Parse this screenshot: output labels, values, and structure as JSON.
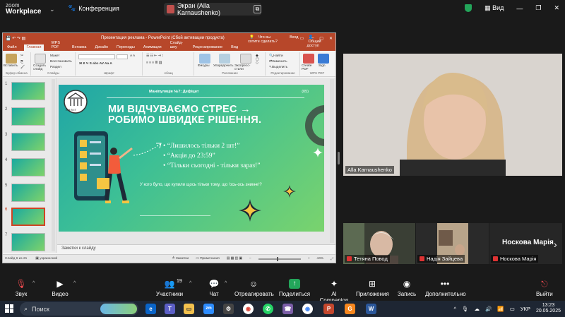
{
  "zoom": {
    "logo_top": "zoom",
    "logo_bottom": "Workplace",
    "meeting_title": "Конференция",
    "share_label": "Экран (Alla Karnaushenko)",
    "view_label": "Вид"
  },
  "ppt": {
    "window_title": "Презентация реклама - PowerPoint (Сбой активации продукта)",
    "tabs": [
      "Файл",
      "Главная",
      "WPS PDF",
      "Вставка",
      "Дизайн",
      "Переходы",
      "Анимация",
      "Слайд-шоу",
      "Рецензирование",
      "Вид"
    ],
    "active_tab": "Главная",
    "tell_me": "Что вы хотите сделать?",
    "login": "Вход",
    "share": "Общий доступ",
    "ribbon": {
      "paste": "Вставить",
      "cut": "Макет",
      "copy": "Восстановить",
      "format": "Раздел",
      "new_slide": "Создать слайд",
      "clipboard": "Буфер обмена",
      "slides": "Слайды",
      "font": "Шрифт",
      "paragraph": "Абзац",
      "shapes": "Фигуры",
      "arrange": "Упорядочить",
      "quick_styles": "Экспресс-стили",
      "drawing": "Рисование",
      "find": "Найти",
      "replace": "Заменить",
      "select": "Выделить",
      "editing": "Редактирование",
      "create_pdf": "Create PDF",
      "sign": "Sign",
      "wps_pdf": "WPS PDF"
    },
    "thumb_numbers": [
      "1",
      "2",
      "3",
      "4",
      "5",
      "6",
      "7"
    ],
    "notes_placeholder": "Заметки к слайду",
    "status_slide": "Слайд 6 из 21",
    "status_lang": "украинский",
    "status_notes": "Заметки",
    "status_comments": "Примечания",
    "status_zoom": "44%"
  },
  "slide": {
    "subtitle": "Маніпуляція №7: Дефіцит",
    "number": "(05)",
    "logo_text": "ПОЛІГ",
    "title_line1": "МИ ВІДЧУВАЄМО СТРЕС →",
    "title_line2": "РОБИМО ШВИДКЕ РІШЕННЯ.",
    "bullets": [
      "“Лишилось тільки 2 шт!”",
      "“Акція до 23:59”",
      "“Тільки сьогодні - тільки зараз!”"
    ],
    "note": "У кого було, що купили щось тільки тому, що 'ось-ось зникне'?"
  },
  "participants": {
    "speaker_name": "Alla Karnaushenko",
    "tile1_name": "Тетяна Повод",
    "tile2_name": "Надія Зайцева",
    "tile3_title": "Носкова Марія",
    "tile3_name": "Носкова Марія"
  },
  "toolbar": {
    "audio": "Звук",
    "video": "Видео",
    "participants": "Участники",
    "participants_count": "19",
    "chat": "Чат",
    "react": "Отреагировать",
    "share": "Поделиться",
    "ai": "AI Companion",
    "apps": "Приложения",
    "record": "Запись",
    "more": "Дополнительно",
    "leave": "Выйти"
  },
  "taskbar": {
    "search": "Поиск",
    "lang": "УКР",
    "time": "13:23",
    "date": "20.05.2025"
  },
  "colors": {
    "ppt_accent": "#b7472a",
    "zoom_bg": "#1a1a1a",
    "share_green": "#23a55a",
    "leave_red": "#e5484d"
  }
}
